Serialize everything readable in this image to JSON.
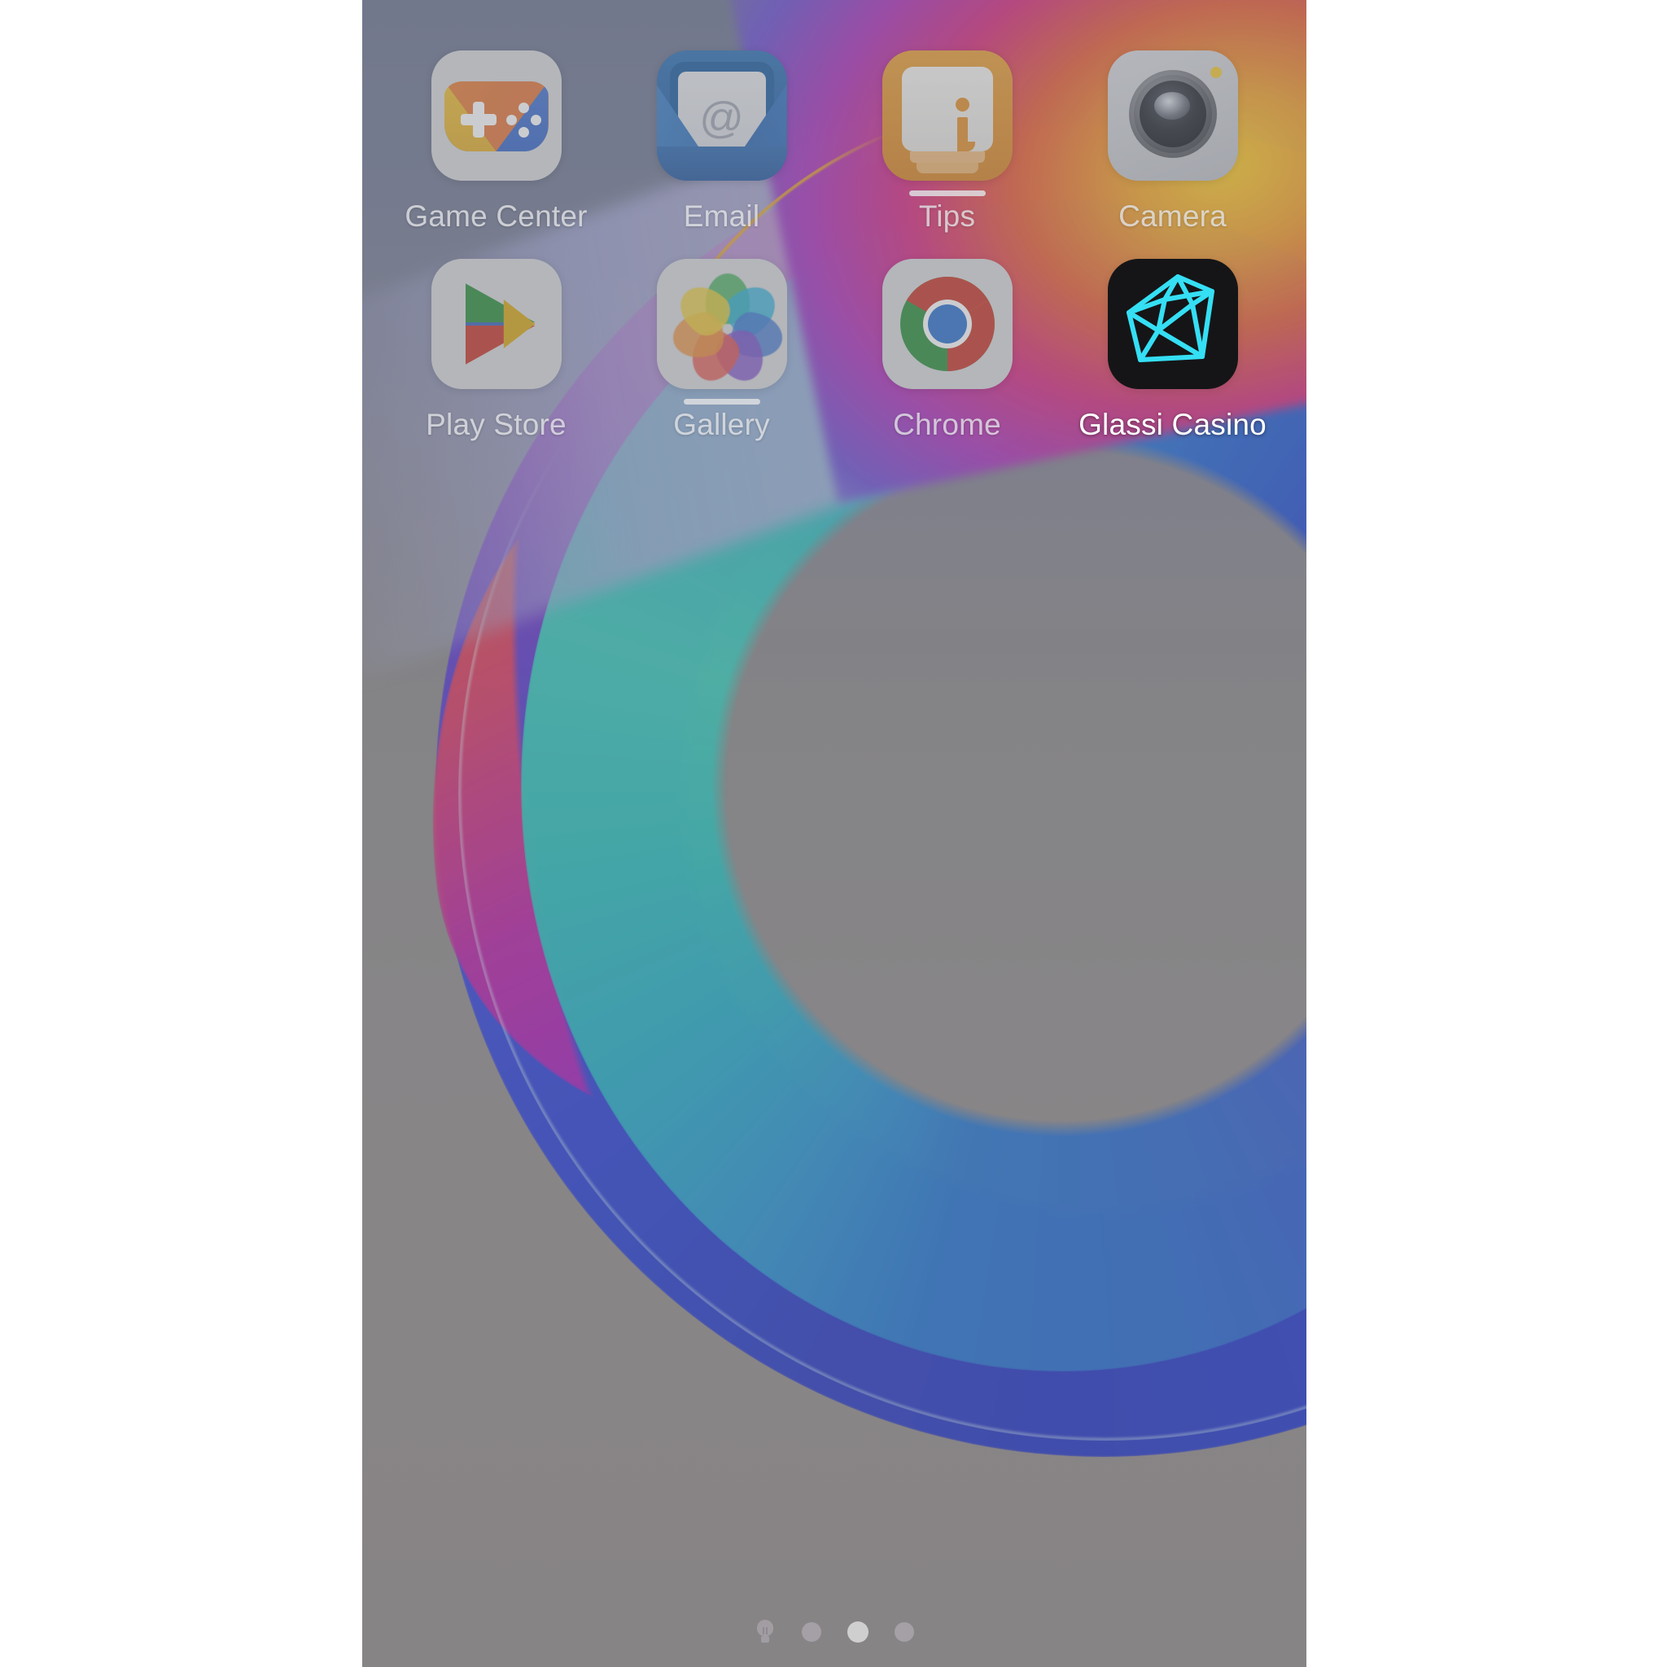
{
  "screen": {
    "type": "android-home-screen",
    "background_color": "#8a8a8c"
  },
  "apps": [
    {
      "label": "Game Center",
      "icon": "game-controller-icon",
      "row": 1,
      "col": 1,
      "highlighted": false,
      "has_notification_bar": false
    },
    {
      "label": "Email",
      "icon": "envelope-at-icon",
      "row": 1,
      "col": 2,
      "highlighted": false,
      "has_notification_bar": false
    },
    {
      "label": "Tips",
      "icon": "info-card-icon",
      "row": 1,
      "col": 3,
      "highlighted": false,
      "has_notification_bar": true
    },
    {
      "label": "Camera",
      "icon": "camera-lens-icon",
      "row": 1,
      "col": 4,
      "highlighted": false,
      "has_notification_bar": false
    },
    {
      "label": "Play Store",
      "icon": "play-triangle-icon",
      "row": 2,
      "col": 1,
      "highlighted": false,
      "has_notification_bar": false
    },
    {
      "label": "Gallery",
      "icon": "pinwheel-photos-icon",
      "row": 2,
      "col": 2,
      "highlighted": false,
      "has_notification_bar": true
    },
    {
      "label": "Chrome",
      "icon": "chrome-icon",
      "row": 2,
      "col": 3,
      "highlighted": false,
      "has_notification_bar": false
    },
    {
      "label": "Glassi Casino",
      "icon": "cyan-diamond-icon",
      "row": 2,
      "col": 4,
      "highlighted": true,
      "has_notification_bar": false
    }
  ],
  "page_indicator": {
    "bulb_icon": "lightbulb-icon",
    "dot_count": 3,
    "active_index": 1
  },
  "colors": {
    "glassi_icon_background": "#151517",
    "glassi_diamond_stroke": "#35dff4",
    "highlighted_label": "#ffffff",
    "dimmed_label": "#e8e9ec",
    "camera_flash_dot": "#e8c135",
    "tips_orange": "#d98c2c",
    "email_blue": "#2a62a4"
  }
}
